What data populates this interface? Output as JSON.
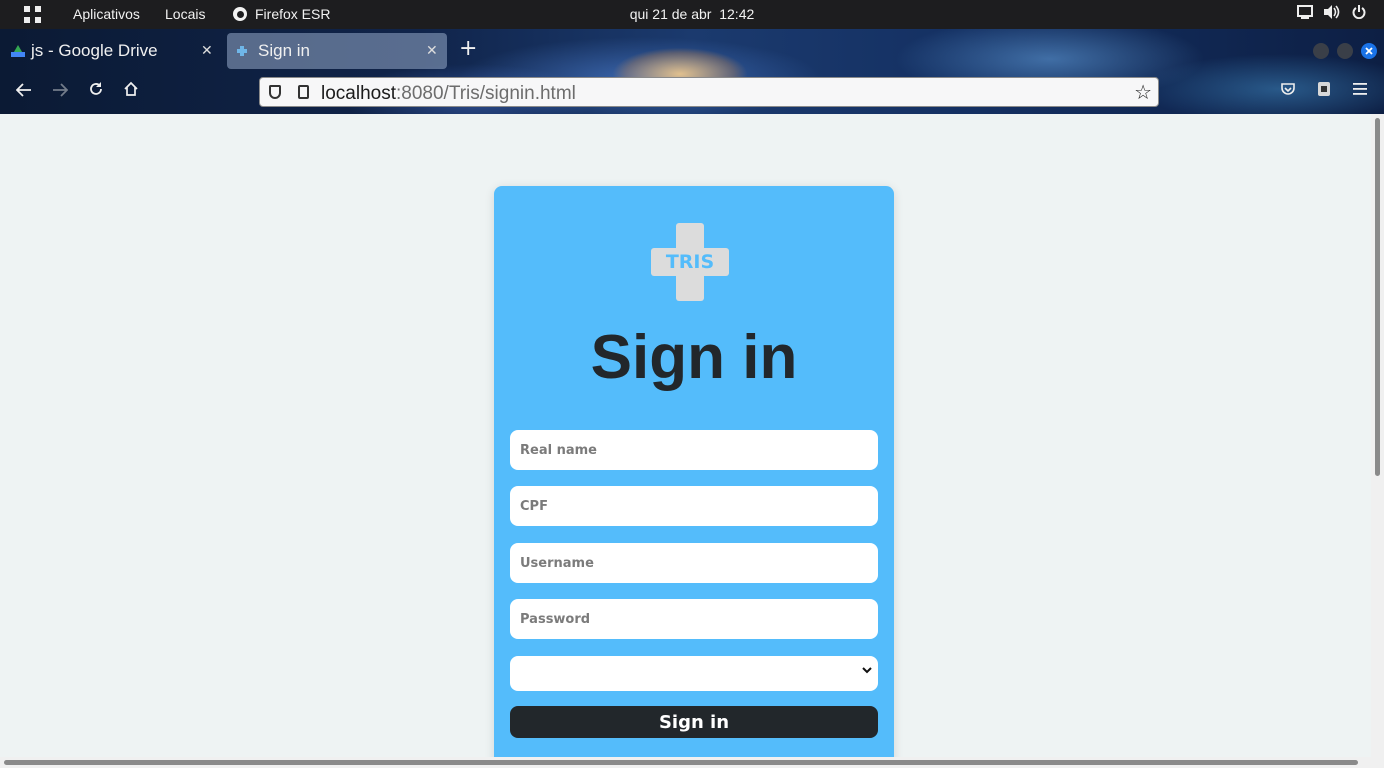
{
  "topbar": {
    "activities_icon": "apps-grid-icon",
    "menu_applications": "Aplicativos",
    "menu_places": "Locais",
    "app_name": "Firefox ESR",
    "clock": "qui 21 de abr  12:42",
    "system_icons": [
      "screen-icon",
      "volume-icon",
      "power-icon"
    ]
  },
  "tabs": [
    {
      "label": "js - Google Drive",
      "icon": "google-drive-icon",
      "active": false
    },
    {
      "label": "Sign in",
      "icon": "tris-plus-icon",
      "active": true
    }
  ],
  "urlbar": {
    "host": "localhost",
    "rest": ":8080/Tris/signin.html"
  },
  "page": {
    "logo_text": "TRIS",
    "title": "Sign in",
    "fields": {
      "real_name_placeholder": "Real name",
      "cpf_placeholder": "CPF",
      "username_placeholder": "Username",
      "password_placeholder": "Password"
    },
    "select_value": "",
    "submit_label": "Sign in"
  },
  "colors": {
    "card": "#54bcfb",
    "page_bg": "#eef3f3",
    "button": "#22272b",
    "logo_cross": "#dcdcdc"
  }
}
